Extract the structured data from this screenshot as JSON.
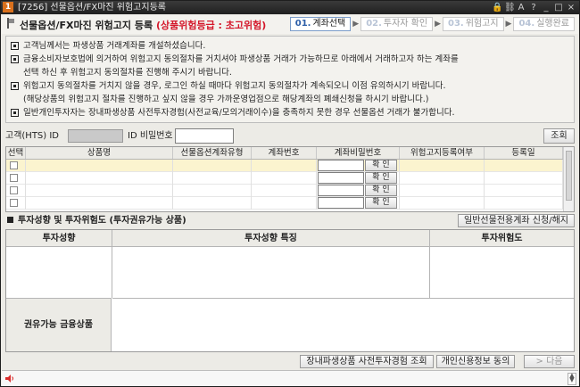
{
  "window": {
    "badge": "1",
    "title": "[7256] 선물옵션/FX마진 위험고지등록",
    "controls": [
      "lock-icon",
      "link-icon",
      "font-size-icon",
      "help-icon",
      "minimize-icon",
      "maximize-icon",
      "close-icon"
    ],
    "control_glyphs": [
      "🔒",
      "⛓",
      "A",
      "?",
      "_",
      "□",
      "×"
    ]
  },
  "header": {
    "title": "선물옵션/FX마진 위험고지 등록",
    "risk_label": "(상품위험등급 : 초고위험)",
    "steps": [
      {
        "num": "01.",
        "label": "계좌선택",
        "active": true
      },
      {
        "num": "02.",
        "label": "투자자 확인",
        "active": false
      },
      {
        "num": "03.",
        "label": "위험고지",
        "active": false
      },
      {
        "num": "04.",
        "label": "실행완료",
        "active": false
      }
    ],
    "step_arrow": "▶"
  },
  "notice": [
    {
      "bullet": true,
      "text": "고객님께서는 파생상품 거래계좌를 개설하셨습니다."
    },
    {
      "bullet": true,
      "text": "금융소비자보호법에 의거하여 위험고지 동의절차를 거치셔야 파생상품 거래가 가능하므로 아래에서 거래하고자 하는 계좌를"
    },
    {
      "bullet": false,
      "text": "선택 하신 후 위험고지 동의절차를 진행해 주시기 바랍니다."
    },
    {
      "bullet": true,
      "text": "위험고지 동의절차를 거치지 않을 경우, 로그인 하실 때마다 위험고지 동의절차가 계속되오니 이점 유의하시기 바랍니다."
    },
    {
      "bullet": false,
      "text": "(해당상품의 위험고지 절차를 진행하고 싶지 않을 경우 가까운영업점으로 해당계좌의 폐쇄신청을 하시기 바랍니다.)"
    },
    {
      "bullet": true,
      "text": "일반개인투자자는 장내파생상품 사전투자경험(사전교육/모의거래이수)을 충족하지 못한 경우 선물옵션 거래가 불가합니다."
    }
  ],
  "id_row": {
    "customer_id_label": "고객(HTS) ID",
    "customer_id_value": "",
    "password_label": "ID 비밀번호",
    "password_value": "",
    "query_button": "조회"
  },
  "accounts_table": {
    "columns": [
      "선택",
      "상품명",
      "선물옵션계좌유형",
      "계좌번호",
      "계좌비밀번호",
      "위험고지등록여부",
      "등록일"
    ],
    "confirm_label": "확 인",
    "rows": [
      {
        "product": "",
        "type": "",
        "account": "",
        "password": "",
        "status": "",
        "date": ""
      },
      {
        "product": "",
        "type": "",
        "account": "",
        "password": "",
        "status": "",
        "date": ""
      },
      {
        "product": "",
        "type": "",
        "account": "",
        "password": "",
        "status": "",
        "date": ""
      },
      {
        "product": "",
        "type": "",
        "account": "",
        "password": "",
        "status": "",
        "date": ""
      }
    ]
  },
  "investor_section": {
    "title": "투자성향 및 투자위험도 (투자권유가능 상품)",
    "special_account_button": "일반선물전용계좌 신청/해지",
    "col_profile": "투자성향",
    "col_features": "투자성향 특징",
    "col_risk": "투자위험도",
    "recommend_label": "권유가능 금융상품"
  },
  "bottom_buttons": {
    "experience_query": "장내파생상품 사전투자경험 조회",
    "credit_consent": "개인신용정보 동의",
    "next": "> 다음"
  }
}
